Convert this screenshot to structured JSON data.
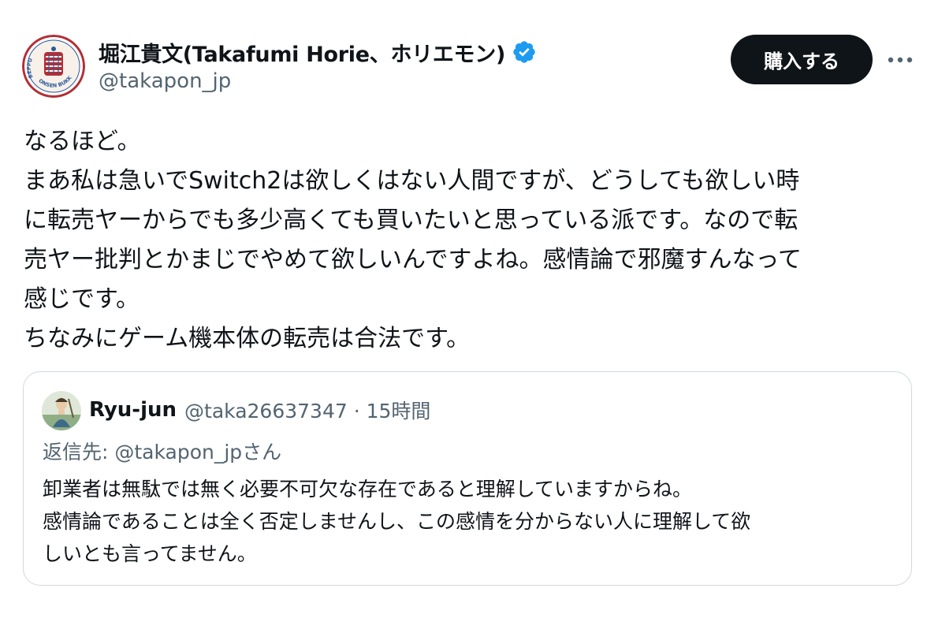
{
  "author": {
    "display_name": "堀江貴文(Takafumi Horie、ホリエモン)",
    "handle": "@takapon_jp",
    "avatar_icon": "onsen-seal-avatar",
    "avatar_text": "BEPPU ONSEN BUKKAKE"
  },
  "actions": {
    "buy_label": "購入する",
    "more_icon": "ellipsis-icon"
  },
  "tweet_lines": [
    "なるほど。",
    "まあ私は急いでSwitch2は欲しくはない人間ですが、どうしても欲しい時",
    "に転売ヤーからでも多少高くても買いたいと思っている派です。なので転",
    "売ヤー批判とかまじでやめて欲しいんですよね。感情論で邪魔すんなって",
    "感じです。",
    "ちなみにゲーム機本体の転売は合法です。"
  ],
  "quoted": {
    "name": "Ryu-jun",
    "meta": "@taka26637347 · 15時間",
    "reply_to": "返信先: @takapon_jpさん",
    "lines": [
      "卸業者は無駄では無く必要不可欠な存在であると理解していますからね。",
      "感情論であることは全く否定しませんし、この感情を分からない人に理解して欲",
      "しいとも言ってません。"
    ]
  },
  "colors": {
    "text": "#0f1419",
    "secondary": "#536471",
    "verified": "#1d9bf0",
    "button_bg": "#0f1419",
    "border": "#cfd9de",
    "avatar_red": "#b32e35"
  }
}
